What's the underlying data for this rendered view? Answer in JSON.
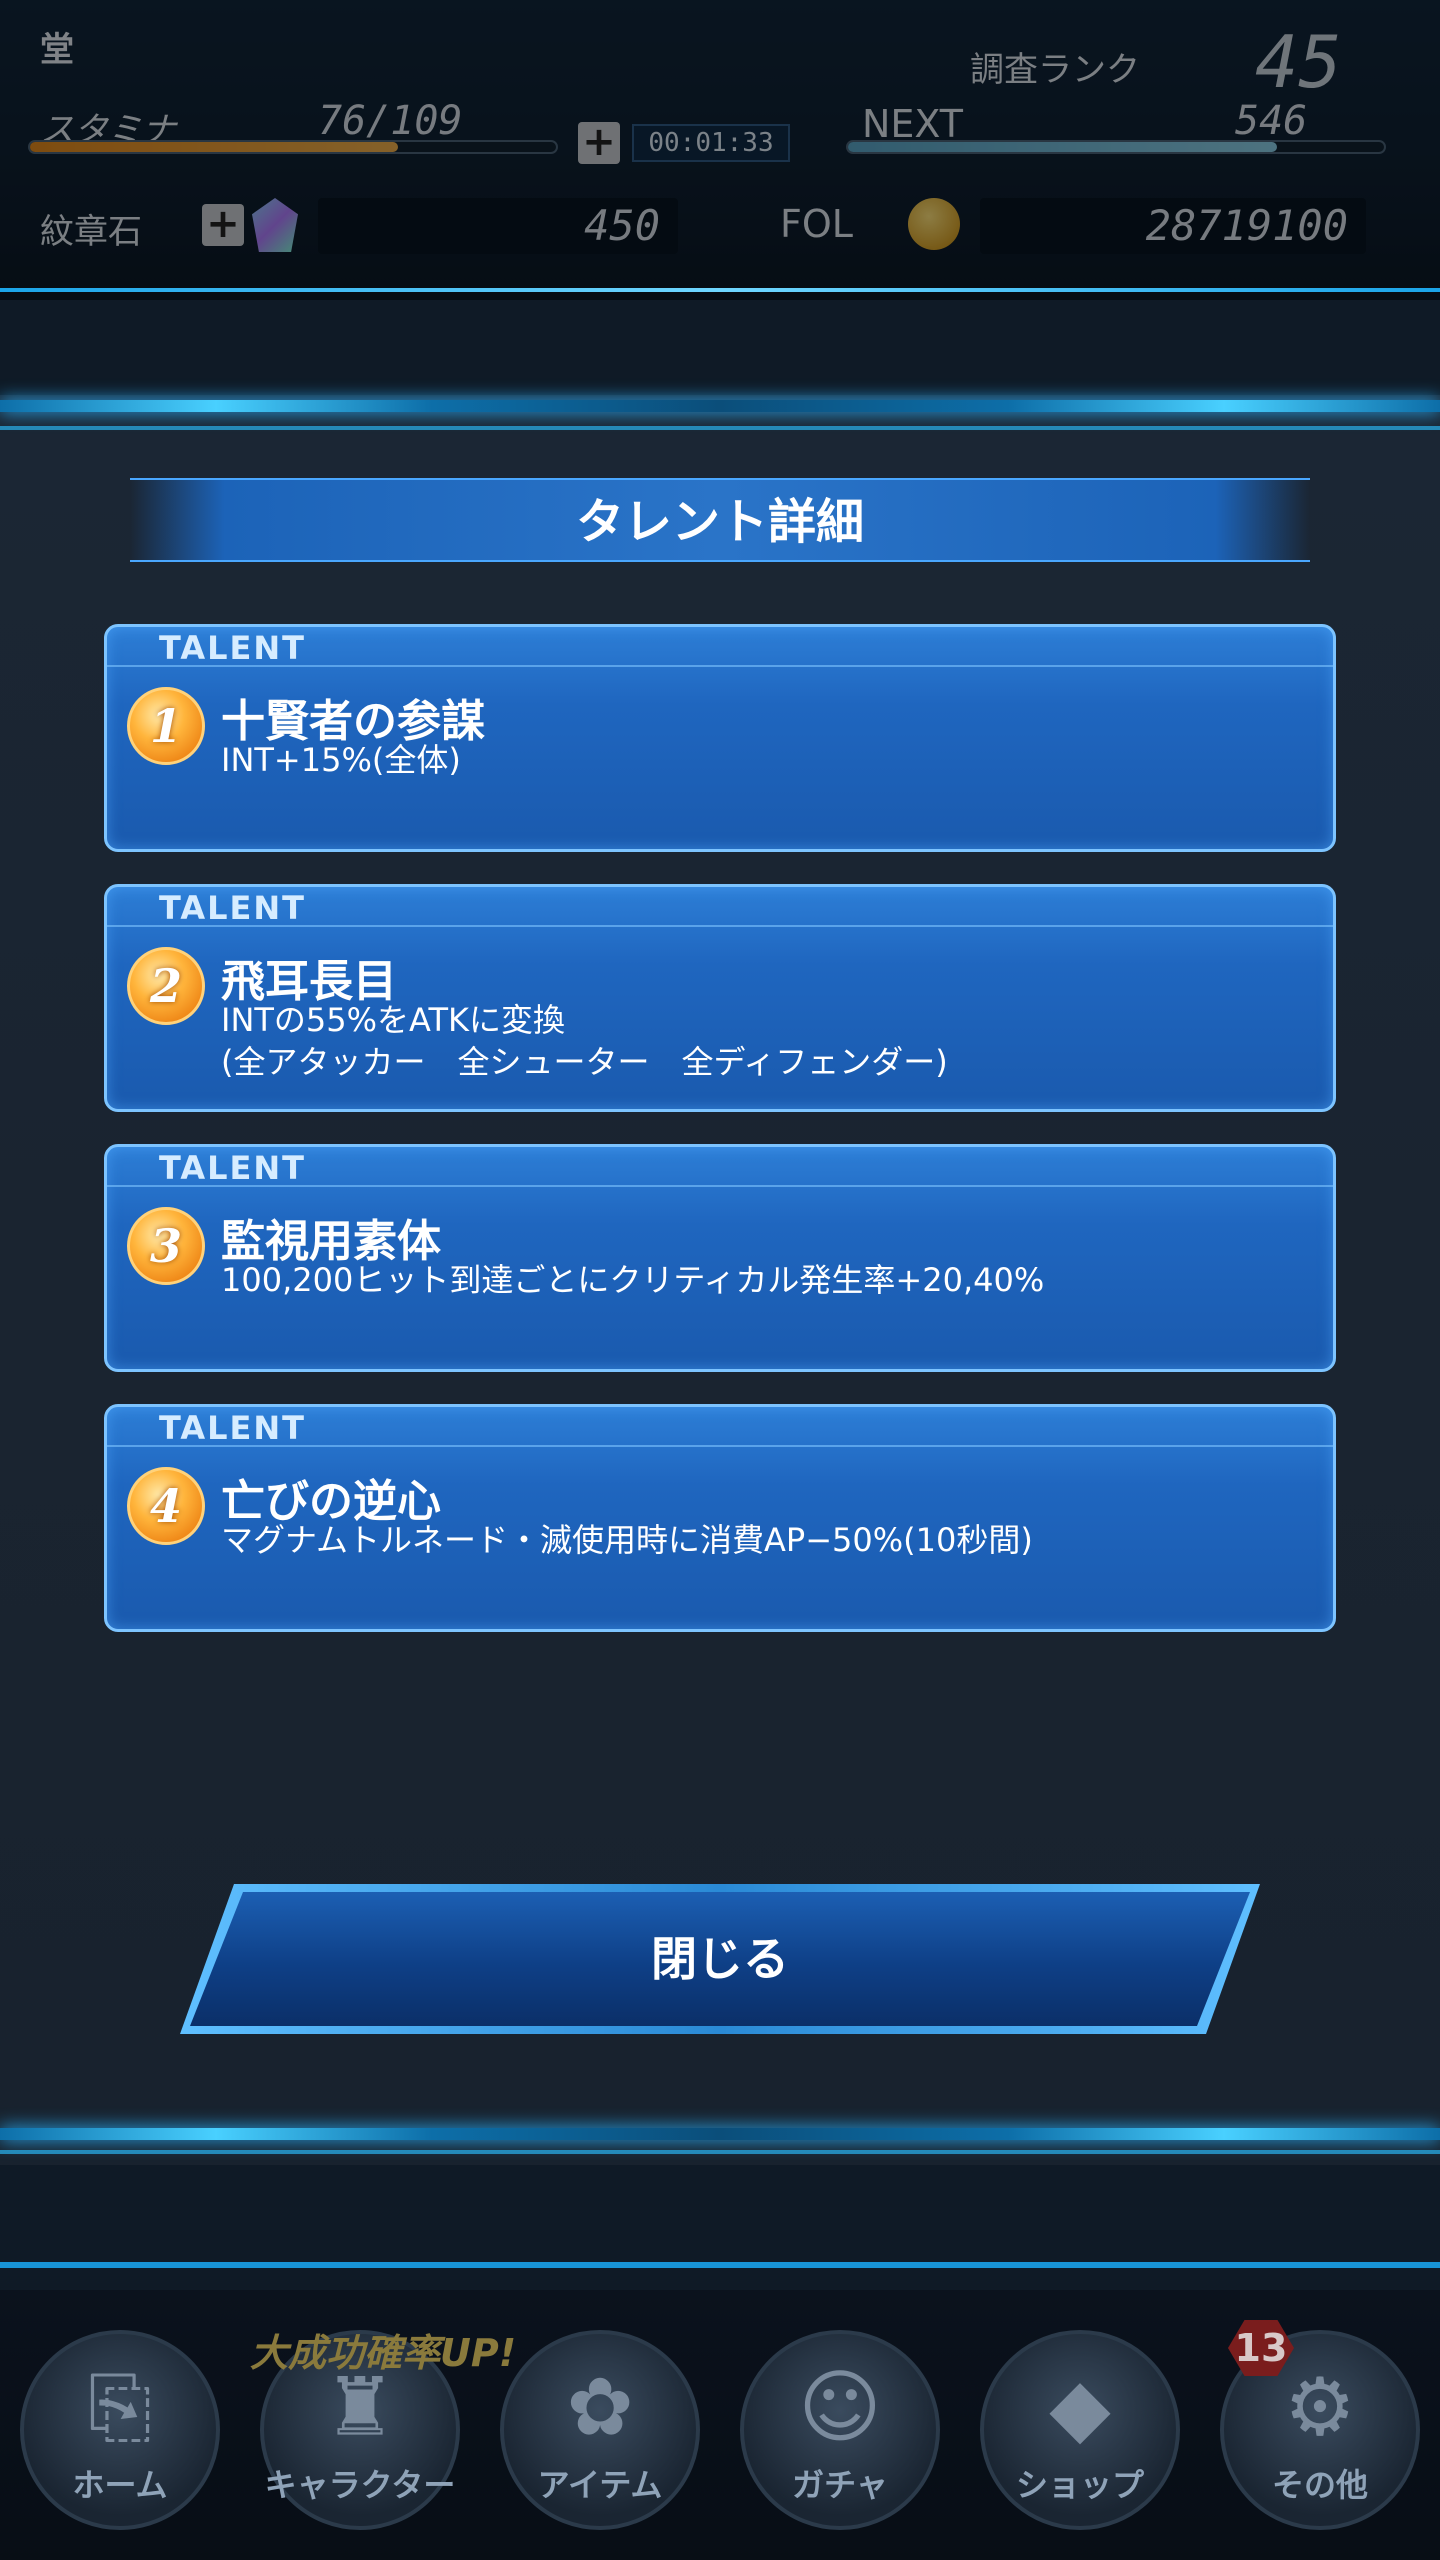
{
  "header": {
    "title": "堂",
    "rank_label": "調査ランク",
    "rank_value": "45",
    "stamina_label": "スタミナ",
    "stamina_value": "76/109",
    "stamina_fraction": 0.7,
    "timer": "00:01:33",
    "next_label": "NEXT",
    "next_value": "546",
    "next_fraction": 0.8,
    "gem_label": "紋章石",
    "gem_value": "450",
    "fol_label": "FOL",
    "fol_value": "28719100"
  },
  "modal": {
    "title": "タレント詳細",
    "talents": [
      {
        "tag": "TALENT",
        "num": "1",
        "name": "十賢者の参謀",
        "desc": "INT+15%(全体)"
      },
      {
        "tag": "TALENT",
        "num": "2",
        "name": "飛耳長目",
        "desc": "INTの55%をATKに変換\n(全アタッカー　全シューター　全ディフェンダー)"
      },
      {
        "tag": "TALENT",
        "num": "3",
        "name": "監視用素体",
        "desc": "100,200ヒット到達ごとにクリティカル発生率+20,40%"
      },
      {
        "tag": "TALENT",
        "num": "4",
        "name": "亡びの逆心",
        "desc": "マグナムトルネード・滅使用時に消費AP−50%(10秒間)"
      }
    ],
    "close_label": "閉じる"
  },
  "nav": {
    "promo": "大成功確率UP!",
    "badge": "13",
    "items": [
      {
        "label": "ホーム",
        "icon": "door-icon"
      },
      {
        "label": "キャラクター",
        "icon": "character-icon"
      },
      {
        "label": "アイテム",
        "icon": "bag-icon"
      },
      {
        "label": "ガチャ",
        "icon": "gacha-icon"
      },
      {
        "label": "ショップ",
        "icon": "crystal-icon"
      },
      {
        "label": "その他",
        "icon": "gear-icon"
      }
    ]
  },
  "colors": {
    "accent": "#1ba4e8",
    "card": "#1f66bf",
    "badge": "#ffb53c"
  }
}
